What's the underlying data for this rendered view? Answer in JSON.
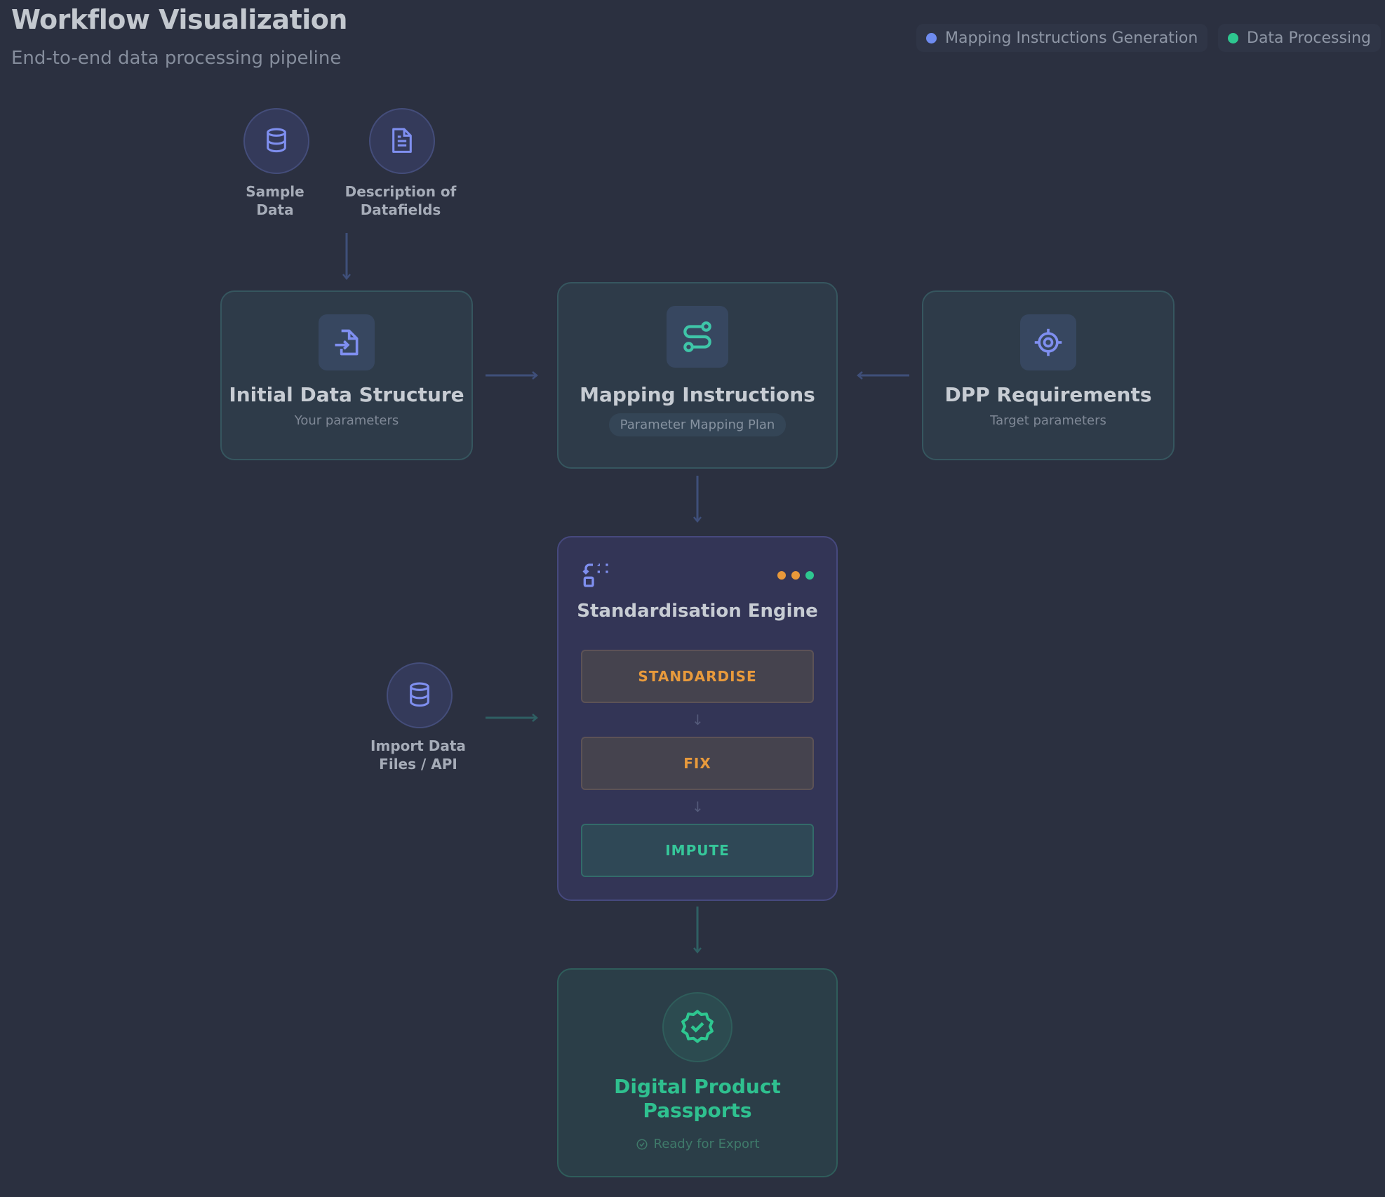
{
  "header": {
    "title": "Workflow Visualization",
    "subtitle": "End-to-end data processing pipeline"
  },
  "legend": [
    {
      "label": "Mapping Instructions Generation",
      "color": "#6f8cf0"
    },
    {
      "label": "Data Processing",
      "color": "#2ec790"
    }
  ],
  "inputs": {
    "sample_data": {
      "label_line1": "Sample",
      "label_line2": "Data",
      "icon": "database-icon"
    },
    "description": {
      "label_line1": "Description of",
      "label_line2": "Datafields",
      "icon": "document-icon"
    },
    "import_data": {
      "label_line1": "Import Data",
      "label_line2": "Files / API",
      "icon": "database-icon"
    }
  },
  "cards": {
    "initial": {
      "title": "Initial Data Structure",
      "subtitle": "Your parameters",
      "icon": "file-import-icon"
    },
    "mapping": {
      "title": "Mapping Instructions",
      "badge": "Parameter Mapping Plan",
      "icon": "route-icon"
    },
    "dpp": {
      "title": "DPP Requirements",
      "subtitle": "Target parameters",
      "icon": "target-icon"
    }
  },
  "engine": {
    "title": "Standardisation Engine",
    "icon": "transform-icon",
    "status_dots": [
      "#e8983a",
      "#e8983a",
      "#2ec790"
    ],
    "steps": [
      {
        "label": "STANDARDISE"
      },
      {
        "label": "FIX"
      },
      {
        "label": "IMPUTE"
      }
    ]
  },
  "output": {
    "title_line1": "Digital Product",
    "title_line2": "Passports",
    "status": "Ready for Export",
    "icon": "verified-badge-icon"
  }
}
